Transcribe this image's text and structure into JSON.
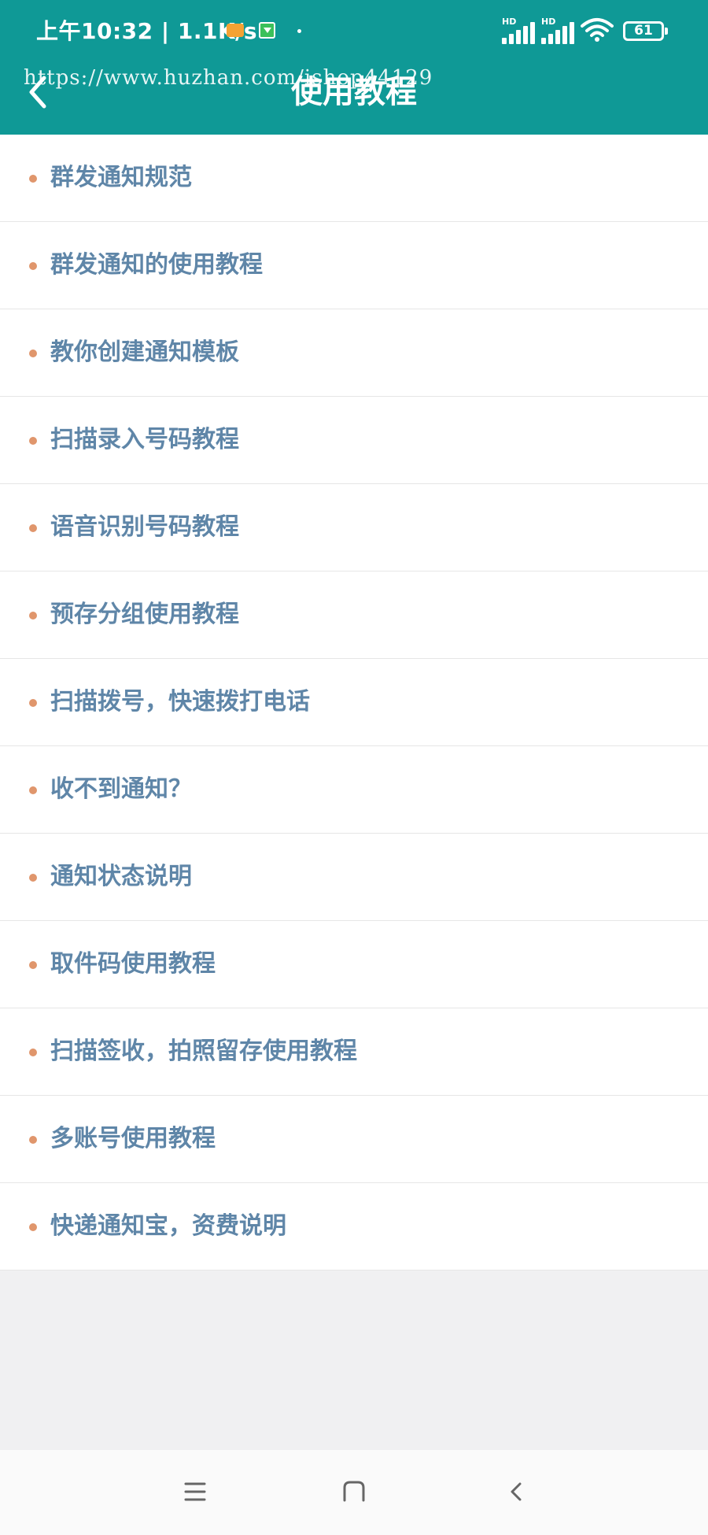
{
  "status_bar": {
    "time": "上午10:32 | 1.1K/s",
    "signal_label": "HD",
    "battery": "61",
    "colors": {
      "orange_notification": "#f4a233",
      "green_notification": "#3bc05a"
    }
  },
  "watermark": "https://www.huzhan.com/ishop44129",
  "header": {
    "title": "使用教程",
    "back_icon": "chevron-left-icon",
    "background_color": "#0f9996"
  },
  "tutorials": [
    {
      "label": "群发通知规范"
    },
    {
      "label": "群发通知的使用教程"
    },
    {
      "label": "教你创建通知模板"
    },
    {
      "label": "扫描录入号码教程"
    },
    {
      "label": "语音识别号码教程"
    },
    {
      "label": "预存分组使用教程"
    },
    {
      "label": "扫描拨号，快速拨打电话"
    },
    {
      "label": "收不到通知？"
    },
    {
      "label": "通知状态说明"
    },
    {
      "label": "取件码使用教程"
    },
    {
      "label": "扫描签收，拍照留存使用教程"
    },
    {
      "label": "多账号使用教程"
    },
    {
      "label": "快递通知宝，资费说明"
    }
  ],
  "list_style": {
    "text_color": "#5f86a8",
    "bullet_color": "#e0966c"
  },
  "nav_bar": {
    "icons": [
      "menu-icon",
      "home-icon",
      "back-icon"
    ]
  }
}
